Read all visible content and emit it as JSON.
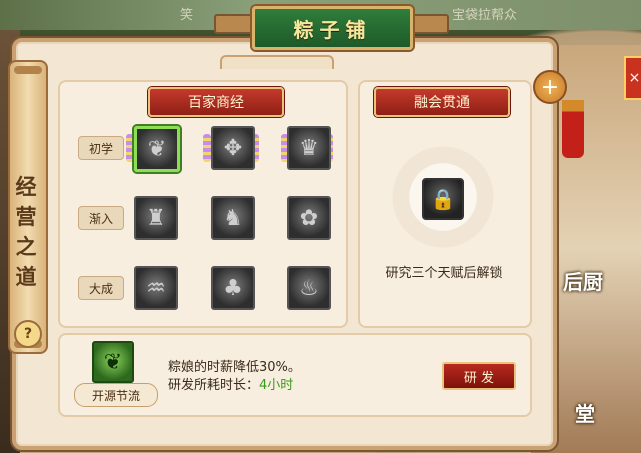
{
  "window": {
    "title": "粽子铺"
  },
  "sidebar": {
    "title_chars": [
      "经",
      "营",
      "之",
      "道"
    ],
    "help_label": "?"
  },
  "talents": {
    "banner": "百家商经",
    "tiers": [
      {
        "label": "初学",
        "skills": [
          "❦",
          "✥",
          "♛"
        ]
      },
      {
        "label": "渐入",
        "skills": [
          "♜",
          "♞",
          "✿"
        ]
      },
      {
        "label": "大成",
        "skills": [
          "♒",
          "♣",
          "♨"
        ]
      }
    ]
  },
  "mastery": {
    "banner": "融会贯通",
    "lock_icon": "🔒",
    "unlock_text": "研究三个天赋后解锁"
  },
  "detail": {
    "name": "开源节流",
    "icon": "❦",
    "effect": "粽娘的时薪降低30%。",
    "duration_prefix": "研发所耗时长：",
    "duration_value": "4小时",
    "research_button": "研 发"
  },
  "background": {
    "top_left_text": "笑",
    "top_right_text": "宝袋拉帮众",
    "right_label_1": "后厨",
    "right_label_2": "堂"
  },
  "controls": {
    "close_label": "+",
    "side_close_label": "×"
  }
}
